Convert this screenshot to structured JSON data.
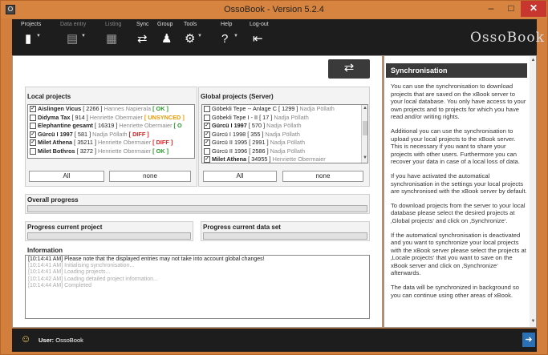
{
  "window": {
    "title": "OssoBook - Version 5.2.4",
    "app_icon": "o-icon",
    "min": "–",
    "max": "□",
    "close": "✕"
  },
  "toolbar": {
    "groups": [
      {
        "label": "Projects",
        "dim": false
      },
      {
        "label": "Data entry",
        "dim": true
      },
      {
        "label": "Listing",
        "dim": true
      },
      {
        "label": "Sync",
        "dim": false
      },
      {
        "label": "Group",
        "dim": false
      },
      {
        "label": "Tools",
        "dim": false
      },
      {
        "label": "Help",
        "dim": false
      },
      {
        "label": "Log-out",
        "dim": false
      }
    ],
    "logo": "OssoBook"
  },
  "sync_button_icon": "⇄",
  "local": {
    "title": "Local projects",
    "rows": [
      {
        "checked": true,
        "name": "Aislingen Vicus",
        "id": "[ 2266 ]",
        "owner": "Hannes Napierala",
        "status": "[ OK ]",
        "status_type": "ok"
      },
      {
        "checked": false,
        "name": "Didyma Tax",
        "id": "[ 914 ]",
        "owner": "Henriette Obermaier",
        "status": "[ UNSYNCED ]",
        "status_type": "uns"
      },
      {
        "checked": false,
        "name": "Elephantine gesamt",
        "id": "[ 16319 ]",
        "owner": "Henriette Obermaier",
        "status": "[ O",
        "status_type": "ok"
      },
      {
        "checked": true,
        "name": "Gürcü I 1997",
        "id": "[ 581 ]",
        "owner": "Nadja Pöllath",
        "status": "[ DIFF ]",
        "status_type": "dif"
      },
      {
        "checked": true,
        "name": "Milet Athena",
        "id": "[ 35211 ]",
        "owner": "Henriette Obermaier",
        "status": "[ DIFF ]",
        "status_type": "dif"
      },
      {
        "checked": false,
        "name": "Milet Bothros",
        "id": "[ 3272 ]",
        "owner": "Henriette Obermaier",
        "status": "[ OK ]",
        "status_type": "ok"
      }
    ],
    "all": "All",
    "none": "none"
  },
  "global": {
    "title": "Global projects (Server)",
    "rows": [
      {
        "checked": false,
        "name": "Göbekli Tepe -- Anlage C",
        "id": "[ 1299 ]",
        "owner": "Nadja Pöllath",
        "bold": false
      },
      {
        "checked": false,
        "name": "Göbekli Tepe I - II",
        "id": "[ 17 ]",
        "owner": "Nadja Pöllath",
        "bold": false
      },
      {
        "checked": true,
        "name": "Gürcü I 1997",
        "id": "[ 570 ]",
        "owner": "Nadja Pöllath",
        "bold": true
      },
      {
        "checked": true,
        "name": "Gürcü I 1998",
        "id": "[ 355 ]",
        "owner": "Nadja Pöllath",
        "bold": false
      },
      {
        "checked": true,
        "name": "Gürcü II 1995",
        "id": "[ 2991 ]",
        "owner": "Nadja Pöllath",
        "bold": false
      },
      {
        "checked": false,
        "name": "Gürcü II 1996",
        "id": "[ 2586 ]",
        "owner": "Nadja Pöllath",
        "bold": false
      },
      {
        "checked": true,
        "name": "Milet Athena",
        "id": "[ 34955 ]",
        "owner": "Henriette Obermaier",
        "bold": true
      }
    ],
    "all": "All",
    "none": "none"
  },
  "overall_progress": {
    "title": "Overall progress",
    "value": 0
  },
  "progress_project": {
    "title": "Progress current project",
    "value": 0
  },
  "progress_dataset": {
    "title": "Progress current data set",
    "value": 0
  },
  "information": {
    "title": "Information",
    "lines": [
      "[10:14:41 AM] Please note that the displayed entries may not take into account global changes!",
      "[10:14:41 AM] Initialising synchronisation...",
      "[10:14:41 AM] Loading projects...",
      "[10:14:42 AM] Loading detailed project information...",
      "[10:14:44 AM] Completed"
    ]
  },
  "help": {
    "title": "Synchronisation",
    "paragraphs": [
      "You can use the synchronisation to download projects that are saved on the xBook server to your local database. You only have access to your own projects and to projects for which you have read and/or writing rights.",
      "Additional you can use the synchronisation to upload your local projects to the xBook server. This is necessary if you want to share your projects with other users. Furthermore you can recover your data in case of a local loss of data.",
      "If you have activated the automatical synchronisation in the settings your local projects are synchronised with the xBook server by default.",
      "To download projects from the server to your local database please select the desired projects at ‚Global projects‘ and click on ‚Synchronize‘.",
      "If the automatical synchronisation is deactivated and you want to synchronize your local projects with the xBook server please select the projects at ‚Locale projects‘ that you want to save on the xBook server and click on ‚Synchronize‘ afterwards.",
      "The data will be synchronized in background so you can continue using other areas of xBook."
    ]
  },
  "status": {
    "user_label": "User:",
    "user_name": "OssoBook"
  }
}
